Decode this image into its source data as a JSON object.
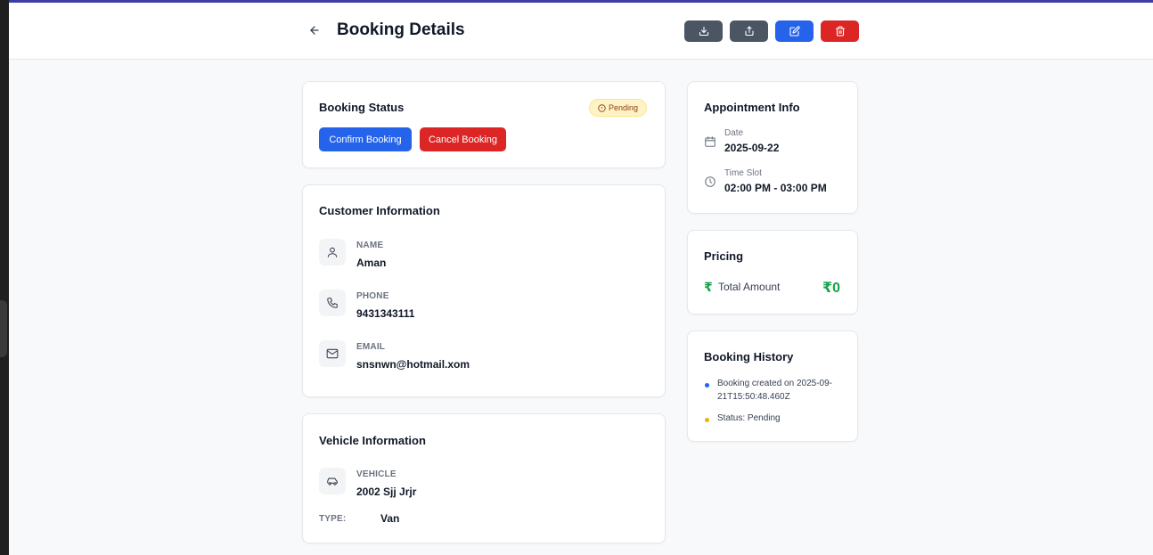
{
  "header": {
    "title": "Booking Details"
  },
  "status_card": {
    "title": "Booking Status",
    "badge": "Pending",
    "confirm_label": "Confirm Booking",
    "cancel_label": "Cancel Booking"
  },
  "customer": {
    "title": "Customer Information",
    "name_label": "NAME",
    "name_value": "Aman",
    "phone_label": "PHONE",
    "phone_value": "9431343111",
    "email_label": "EMAIL",
    "email_value": "snsnwn@hotmail.xom"
  },
  "vehicle": {
    "title": "Vehicle Information",
    "vehicle_label": "VEHICLE",
    "vehicle_value": "2002 Sjj Jrjr",
    "type_label": "TYPE:",
    "type_value": "Van"
  },
  "appointment": {
    "title": "Appointment Info",
    "date_label": "Date",
    "date_value": "2025-09-22",
    "slot_label": "Time Slot",
    "slot_value": "02:00 PM - 03:00 PM"
  },
  "pricing": {
    "title": "Pricing",
    "currency_symbol": "₹",
    "total_label": "Total Amount",
    "total_value": "₹0"
  },
  "history": {
    "title": "Booking History",
    "items": [
      {
        "text": "Booking created on 2025-09-21T15:50:48.460Z",
        "color": "#2563eb"
      },
      {
        "text": "Status: Pending",
        "color": "#eab308"
      }
    ]
  },
  "colors": {
    "primary": "#2563eb",
    "danger": "#dc2626",
    "neutral_button": "#4b5563",
    "pending_bg": "#fef3c7",
    "price_green": "#16a34a"
  },
  "icons": {
    "back": "arrow-left-icon",
    "download": "download-icon",
    "share": "share-icon",
    "edit": "edit-icon",
    "delete": "trash-icon",
    "name": "user-icon",
    "phone": "phone-icon",
    "email": "mail-icon",
    "vehicle": "car-icon",
    "date": "calendar-icon",
    "slot": "clock-icon",
    "pending": "info-circle-icon"
  }
}
